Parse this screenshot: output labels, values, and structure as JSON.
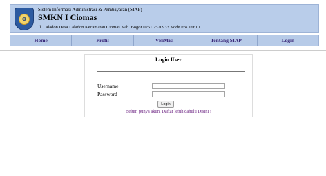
{
  "header": {
    "subtitle": "Sistem Informasi Administrasi & Pembayaran (SIAP)",
    "title": "SMKN I Ciomas",
    "address": "Jl. Laladon Desa Laladon Kecamatan Ciomas Kab. Bogor 0251 7520933 Kode Pos 16610",
    "logo_icon": "school-crest-icon"
  },
  "nav": {
    "items": [
      {
        "label": "Home"
      },
      {
        "label": "Profil"
      },
      {
        "label": "VisiMisi"
      },
      {
        "label": "Tentang SIAP"
      },
      {
        "label": "Login"
      }
    ]
  },
  "login": {
    "title": "Login User",
    "username_label": "Username",
    "username_value": "",
    "password_label": "Password",
    "password_value": "",
    "button_label": "Login",
    "register_text": "Belum punya akun, Daftar lebih dahulu Disini !"
  },
  "colors": {
    "header_bg": "#b9cdea",
    "nav_text": "#3b2a7a",
    "register_text": "#6a2080"
  }
}
